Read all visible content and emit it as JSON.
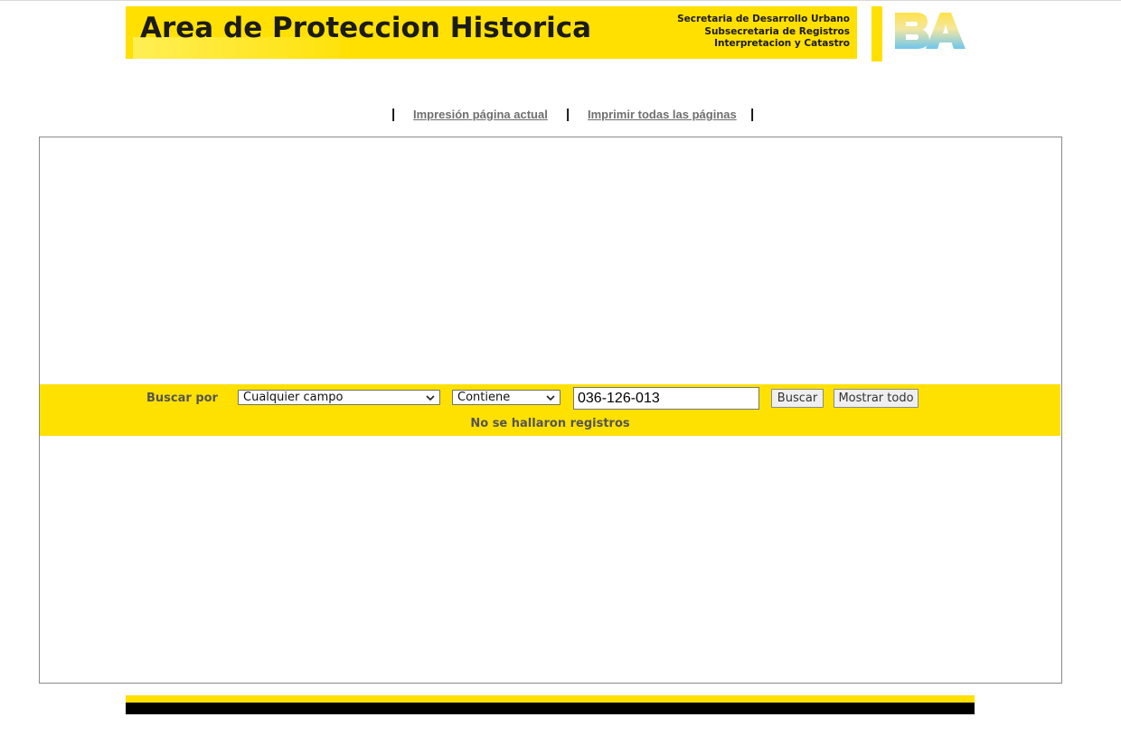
{
  "header": {
    "title": "Area de Proteccion Historica",
    "subtitle_lines": [
      "Secretaria de Desarrollo Urbano",
      "Subsecretaria de Registros",
      "Interpretacion y Catastro"
    ],
    "logo_text": "BA",
    "accent_color": "#ffe000"
  },
  "print_links": {
    "separator": "|",
    "current_page": "Impresión página actual",
    "all_pages": "Imprimir todas las páginas"
  },
  "search": {
    "label": "Buscar por",
    "field_select": {
      "selected": "Cualquier campo"
    },
    "operator_select": {
      "selected": "Contiene"
    },
    "query_value": "036-126-013",
    "search_button": "Buscar",
    "show_all_button": "Mostrar todo",
    "result_message": "No se hallaron registros"
  },
  "colors": {
    "band": "#ffe100",
    "footer_black": "#000000"
  }
}
